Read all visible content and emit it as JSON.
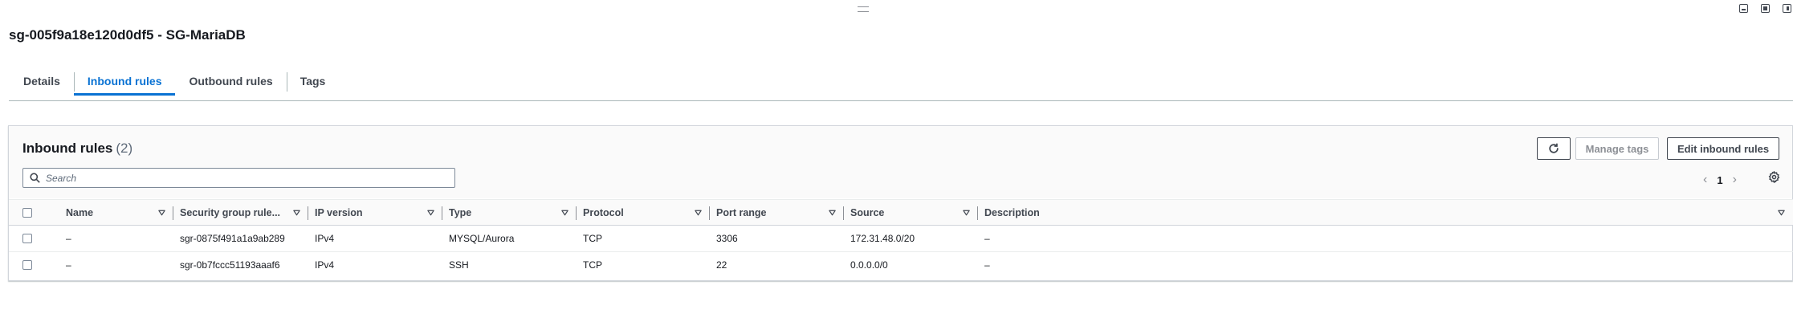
{
  "page": {
    "title": "sg-005f9a18e120d0df5 - SG-MariaDB"
  },
  "tabs": [
    {
      "label": "Details"
    },
    {
      "label": "Inbound rules",
      "active": true
    },
    {
      "label": "Outbound rules"
    },
    {
      "label": "Tags"
    }
  ],
  "panel": {
    "title": "Inbound rules",
    "count": "(2)",
    "manage_tags_label": "Manage tags",
    "edit_label": "Edit inbound rules",
    "search_placeholder": "Search",
    "search_value": "",
    "page_number": "1"
  },
  "columns": [
    "Name",
    "Security group rule...",
    "IP version",
    "Type",
    "Protocol",
    "Port range",
    "Source",
    "Description"
  ],
  "rows": [
    {
      "name": "–",
      "rule_id": "sgr-0875f491a1a9ab289",
      "ip_version": "IPv4",
      "type": "MYSQL/Aurora",
      "protocol": "TCP",
      "port_range": "3306",
      "source": "172.31.48.0/20",
      "description": "–"
    },
    {
      "name": "–",
      "rule_id": "sgr-0b7fccc51193aaaf6",
      "ip_version": "IPv4",
      "type": "SSH",
      "protocol": "TCP",
      "port_range": "22",
      "source": "0.0.0.0/0",
      "description": "–"
    }
  ],
  "icons": {
    "refresh": "refresh-icon",
    "search": "search-icon",
    "prev": "chevron-left-icon",
    "next": "chevron-right-icon",
    "settings": "gear-icon",
    "sort": "caret-down-icon"
  },
  "colors": {
    "accent": "#0972d3",
    "text": "#16191f",
    "muted": "#5f6b7a",
    "border": "#aab7b8"
  }
}
